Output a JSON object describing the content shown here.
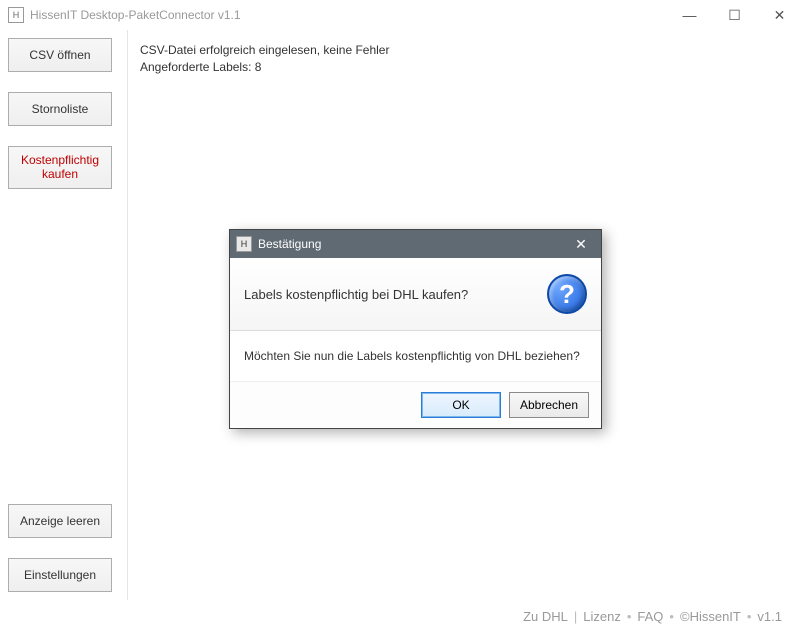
{
  "window": {
    "title": "HissenIT Desktop-PaketConnector v1.1"
  },
  "sidebar": {
    "csv_open": "CSV öffnen",
    "storno": "Stornoliste",
    "buy": "Kostenpflichtig\nkaufen",
    "clear": "Anzeige leeren",
    "settings": "Einstellungen"
  },
  "content": {
    "status_line1": "CSV-Datei erfolgreich eingelesen, keine Fehler",
    "status_line2": "Angeforderte Labels: 8"
  },
  "dialog": {
    "title": "Bestätigung",
    "question": "Labels kostenpflichtig bei DHL kaufen?",
    "body": "Möchten Sie nun die Labels kostenpflichtig von DHL beziehen?",
    "ok": "OK",
    "cancel": "Abbrechen"
  },
  "footer": {
    "zu_dhl": "Zu DHL",
    "lizenz": "Lizenz",
    "faq": "FAQ",
    "copyright": "©HissenIT",
    "version": "v1.1"
  }
}
